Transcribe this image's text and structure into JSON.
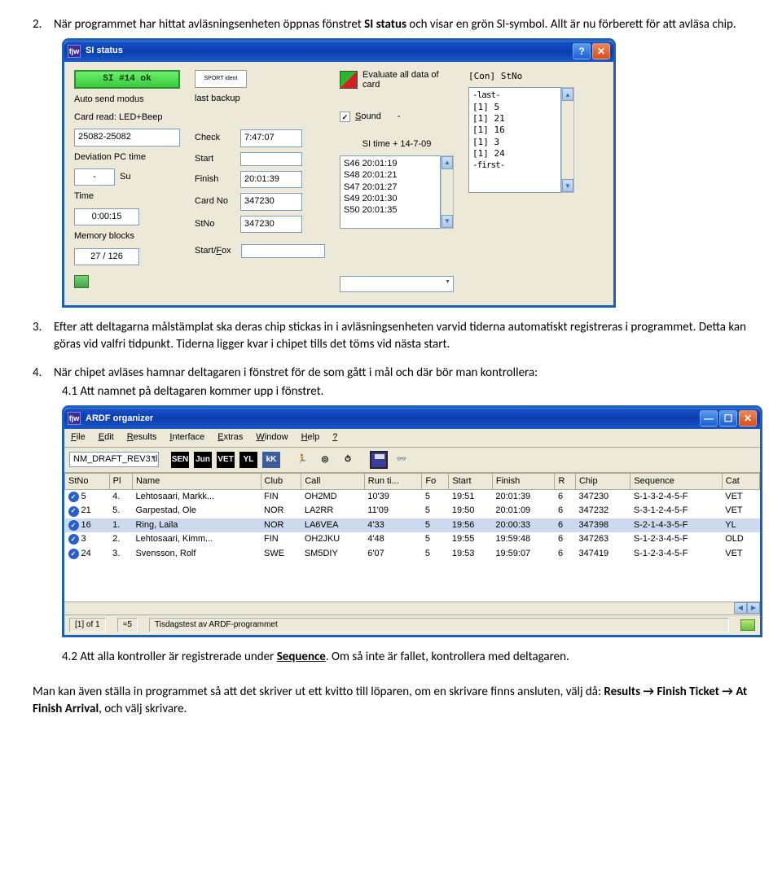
{
  "doc": {
    "p2_num": "2.",
    "p2": "När programmet har hittat avläsningsenheten öppnas fönstret SI status och visar en grön SI-symbol. Allt är nu förberett för att avläsa chip.",
    "p3_num": "3.",
    "p3": "Efter att deltagarna målstämplat ska deras chip stickas in i avläsningsenheten varvid tiderna automatiskt registreras i programmet. Detta kan göras vid valfri tidpunkt. Tiderna ligger kvar i chipet tills det töms vid nästa start.",
    "p4_num": "4.",
    "p4": "När chipet avläses hamnar deltagaren i fönstret för de som gått i mål och där bör man kontrollera:",
    "p41": "4.1 Att namnet på deltagaren kommer upp i fönstret.",
    "p42a": "4.2 Att alla kontroller är registrerade under ",
    "p42b": "Sequence",
    "p42c": ". Om så inte är fallet, kontrollera med deltagaren.",
    "end": "Man kan även ställa in programmet så att det skriver ut ett kvitto till löparen, om en skrivare finns ansluten, välj då: Results → Finish Ticket → At Finish Arrival, och välj skrivare."
  },
  "si": {
    "title": "SI status",
    "ok": "SI #14 ok",
    "auto": "Auto send modus",
    "cardread": "Card read: LED+Beep",
    "range": "25082-25082",
    "devpc": "Deviation PC time",
    "dash": "-",
    "su": "Su",
    "time": "Time",
    "timeval": "0:00:15",
    "mem": "Memory blocks",
    "memval": "27 / 126",
    "lastbackup": "last backup",
    "check": "Check",
    "checkval": "7:47:07",
    "start": "Start",
    "finish": "Finish",
    "finishval": "20:01:39",
    "cardno": "Card No",
    "cardnoval": "347230",
    "stno": "StNo",
    "stnoval": "347230",
    "startfox": "Start/Fox",
    "evalall": "Evaluate all data of card",
    "sound": "Sound",
    "sitime": "SI time + 14-7-09",
    "punches": [
      "S46 20:01:19",
      "S48 20:01:21",
      "S47 20:01:27",
      "S49 20:01:30",
      "S50 20:01:35"
    ],
    "loghdr": "[Con]  StNo",
    "loglast": "-last-",
    "logfirst": "-first-",
    "log": [
      "[1]  5",
      "[1]  21",
      "[1]  16",
      "[1]  3",
      "[1]  24"
    ]
  },
  "org": {
    "title": "ARDF organizer",
    "menu": [
      "File",
      "Edit",
      "Results",
      "Interface",
      "Extras",
      "Window",
      "Help",
      "?"
    ],
    "file": "NM_DRAFT_REV3.tl",
    "cols": [
      "StNo",
      "Pl",
      "Name",
      "Club",
      "Call",
      "Run ti...",
      "Fo",
      "Start",
      "Finish",
      "R",
      "Chip",
      "Sequence",
      "Cat"
    ],
    "rows": [
      {
        "st": "5",
        "pl": "4.",
        "name": "Lehtosaari, Markk...",
        "club": "FIN",
        "call": "OH2MD",
        "run": "10'39",
        "fo": "5",
        "start": "19:51",
        "finish": "20:01:39",
        "r": "6",
        "chip": "347230",
        "seq": "S-1-3-2-4-5-F",
        "cat": "VET"
      },
      {
        "st": "21",
        "pl": "5.",
        "name": "Garpestad, Ole",
        "club": "NOR",
        "call": "LA2RR",
        "run": "11'09",
        "fo": "5",
        "start": "19:50",
        "finish": "20:01:09",
        "r": "6",
        "chip": "347232",
        "seq": "S-3-1-2-4-5-F",
        "cat": "VET"
      },
      {
        "st": "16",
        "pl": "1.",
        "name": "Ring, Laila",
        "club": "NOR",
        "call": "LA6VEA",
        "run": "4'33",
        "fo": "5",
        "start": "19:56",
        "finish": "20:00:33",
        "r": "6",
        "chip": "347398",
        "seq": "S-2-1-4-3-5-F",
        "cat": "YL",
        "sel": true
      },
      {
        "st": "3",
        "pl": "2.",
        "name": "Lehtosaari, Kimm...",
        "club": "FIN",
        "call": "OH2JKU",
        "run": "4'48",
        "fo": "5",
        "start": "19:55",
        "finish": "19:59:48",
        "r": "6",
        "chip": "347263",
        "seq": "S-1-2-3-4-5-F",
        "cat": "OLD"
      },
      {
        "st": "24",
        "pl": "3.",
        "name": "Svensson, Rolf",
        "club": "SWE",
        "call": "SM5DIY",
        "run": "6'07",
        "fo": "5",
        "start": "19:53",
        "finish": "19:59:07",
        "r": "6",
        "chip": "347419",
        "seq": "S-1-2-3-4-5-F",
        "cat": "VET"
      }
    ],
    "status": {
      "a": "[1] of 1",
      "b": "=5",
      "c": "Tisdagstest av ARDF-programmet"
    }
  }
}
